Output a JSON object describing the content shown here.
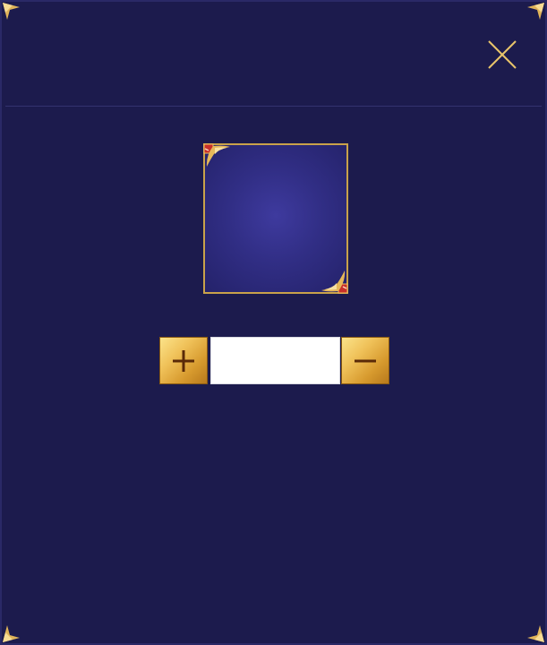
{
  "dialog": {
    "close_icon": "close-icon",
    "accent_color": "#e0b85a",
    "background_color": "#1c1b4d"
  },
  "item_slot": {
    "content": "",
    "corner_icon": "gem-corner-icon"
  },
  "quantity": {
    "increase_icon": "plus-icon",
    "decrease_icon": "minus-icon",
    "value": "",
    "placeholder": ""
  }
}
